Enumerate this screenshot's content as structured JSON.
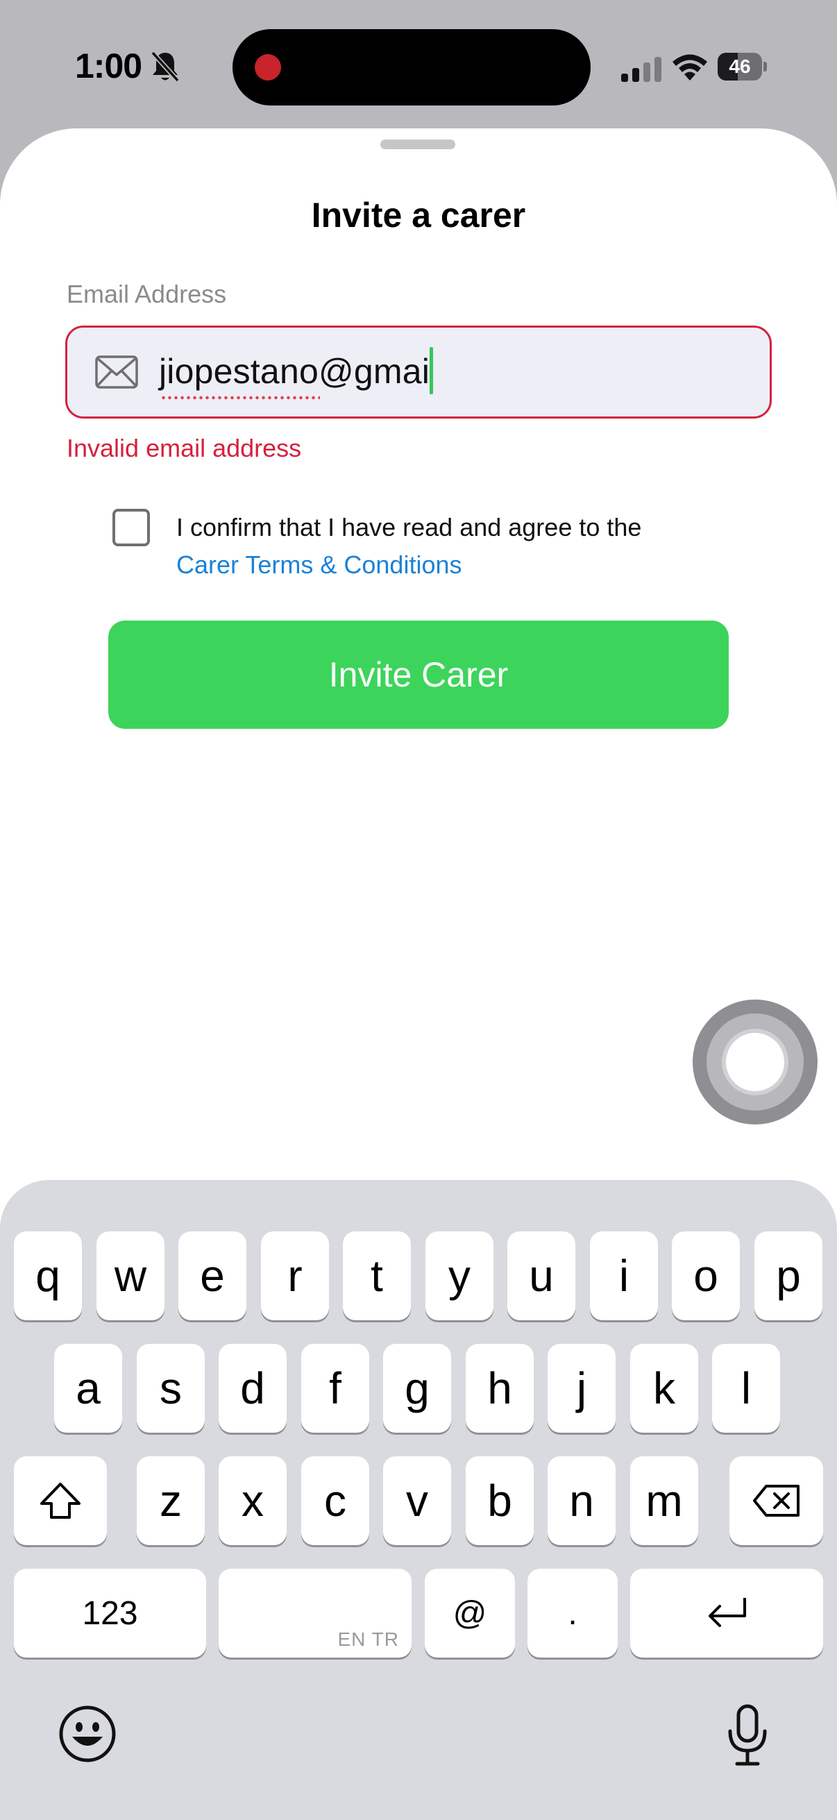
{
  "status_bar": {
    "time": "1:00",
    "battery_level": "46"
  },
  "sheet": {
    "title": "Invite a carer",
    "email_label": "Email Address",
    "email_value": "jiopestano@gmai",
    "error_message": "Invalid email address",
    "consent_text": "I confirm that I have read and agree to the",
    "terms_link": "Carer Terms & Conditions",
    "consent_checked": false,
    "invite_button": "Invite Carer",
    "accent_color": "#3dd45b",
    "error_color": "#d5213d",
    "link_color": "#1a82d8"
  },
  "keyboard": {
    "row1": [
      "q",
      "w",
      "e",
      "r",
      "t",
      "y",
      "u",
      "i",
      "o",
      "p"
    ],
    "row2": [
      "a",
      "s",
      "d",
      "f",
      "g",
      "h",
      "j",
      "k",
      "l"
    ],
    "row3": [
      "z",
      "x",
      "c",
      "v",
      "b",
      "n",
      "m"
    ],
    "numbers_key": "123",
    "space_hint": "EN TR",
    "at_key": "@",
    "dot_key": ".",
    "shift_icon": "shift-icon",
    "delete_icon": "delete-icon",
    "return_icon": "return-icon",
    "emoji_icon": "emoji-icon",
    "mic_icon": "microphone-icon"
  }
}
